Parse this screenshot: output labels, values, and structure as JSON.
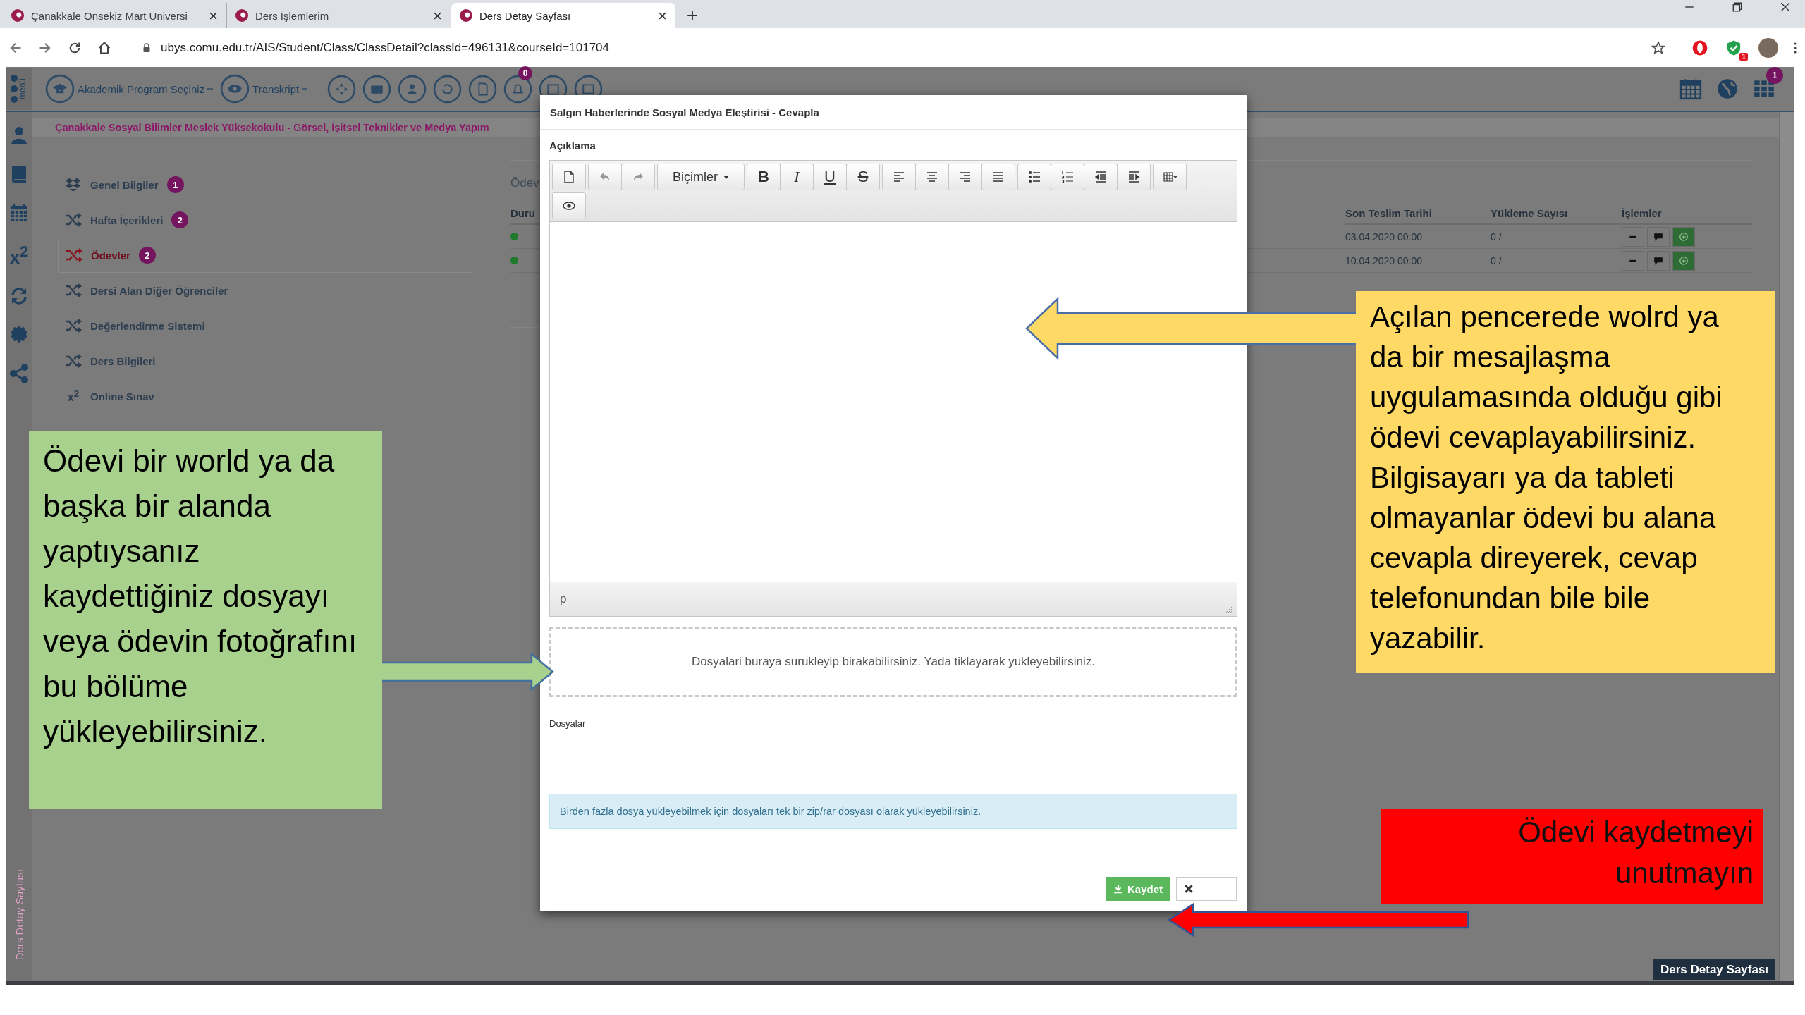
{
  "browser": {
    "tabs": [
      {
        "title": "Çanakkale Onsekiz Mart Üniversi",
        "selected": false
      },
      {
        "title": "Ders İşlemlerim",
        "selected": false
      },
      {
        "title": "Ders Detay Sayfası",
        "selected": true
      }
    ],
    "url": "ubys.comu.edu.tr/AIS/Student/Class/ClassDetail?classId=496131&courseId=101704",
    "extension_badge": "1"
  },
  "topbar": {
    "menu_label": "menü",
    "buttons": [
      "Akademik Program Seçiniz",
      "Transkript"
    ],
    "notification_count": "0",
    "apps_count": "1"
  },
  "rail": {
    "formula_icon": "x$^{2}$",
    "vertical_label": "Ders Detay Sayfası"
  },
  "breadcrumb": "Çanakkale Sosyal Bilimler Meslek Yüksekokulu - Görsel, İşitsel Teknikler ve Medya Yapım",
  "sidebar": {
    "items": [
      {
        "kind": "stack",
        "label": "Genel Bilgiler",
        "badge": "1",
        "selected": false
      },
      {
        "kind": "shuffle",
        "label": "Hafta İçerikleri",
        "badge": "2",
        "selected": false
      },
      {
        "kind": "shuffle",
        "label": "Ödevler",
        "badge": "2",
        "selected": true
      },
      {
        "kind": "shuffle",
        "label": "Dersi Alan Diğer Öğrenciler",
        "selected": false
      },
      {
        "kind": "shuffle",
        "label": "Değerlendirme Sistemi",
        "selected": false
      },
      {
        "kind": "shuffle",
        "label": "Ders Bilgileri",
        "selected": false
      },
      {
        "kind": "formula",
        "icon_text": "x$^{2}$",
        "label": "Online Sınav",
        "selected": false
      }
    ]
  },
  "assignments": {
    "title": "Ödev",
    "status_header": "Duru",
    "headers": [
      "Son Teslim Tarihi",
      "Yükleme Sayısı",
      "İşlemler"
    ],
    "rows": [
      {
        "deadline": "03.04.2020 00:00",
        "uploads": "0 /"
      },
      {
        "deadline": "10.04.2020 00:00",
        "uploads": "0 /"
      }
    ]
  },
  "modal": {
    "title": "Salgın Haberlerinde Sosyal Medya Eleştirisi - Cevapla",
    "field_label": "Açıklama",
    "format_menu": "Biçimler",
    "format_buttons": [
      "B",
      "I",
      "U",
      "S"
    ],
    "path": "p",
    "dropzone": "Dosyalari buraya surukleyip birakabilirsiniz. Yada tiklayarak yukleyebilirsiniz.",
    "files_label": "Dosyalar",
    "info": "Birden fazla dosya yükleyebilmek için dosyaları tek bir zip/rar dosyası olarak yükleyebilirsiniz.",
    "save_button": "Kaydet"
  },
  "callouts": [
    {
      "color": "#ffd966",
      "text": "Açılan pencerede wolrd ya da bir mesajlaşma uygulamasında olduğu gibi ödevi cevaplayabilirsiniz. Bilgisayarı ya da tableti olmayanlar ödevi bu alana cevapla direyerek, cevap telefonundan bile bile yazabilir."
    },
    {
      "color": "#a9d18e",
      "text": "Ödevi bir world ya da başka bir alanda yaptıysanız kaydettiğiniz dosyayı veya ödevin fotoğrafını bu bölüme yükleyebilirsiniz."
    },
    {
      "color": "#ff0000",
      "text": "Ödevi kaydetmeyi unutmayın"
    }
  ],
  "footer_badge": "Ders Detay Sayfası"
}
